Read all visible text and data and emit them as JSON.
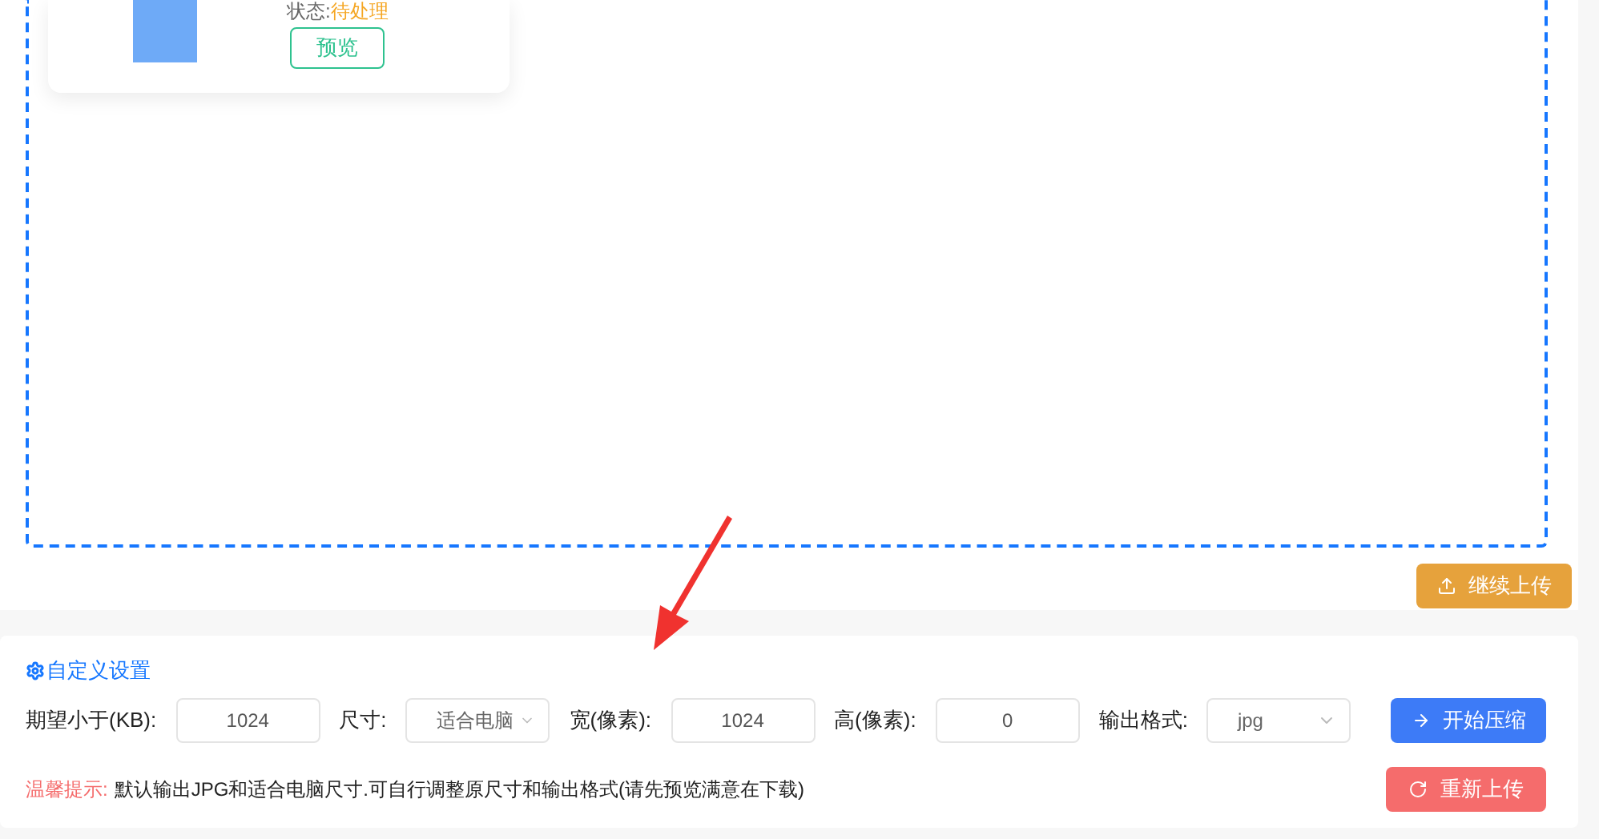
{
  "file_card": {
    "status_label": "状态:",
    "status": "待处理",
    "preview_button": "预览"
  },
  "continue_upload_button": "继续上传",
  "settings": {
    "title": "自定义设置",
    "fields": [
      {
        "kind": "input",
        "label": "期望小于(KB):",
        "value": "1024"
      },
      {
        "kind": "select",
        "label": "尺寸:",
        "value": "适合电脑"
      },
      {
        "kind": "input",
        "label": "宽(像素):",
        "value": "1024"
      },
      {
        "kind": "input",
        "label": "高(像素):",
        "value": "0"
      },
      {
        "kind": "select",
        "label": "输出格式:",
        "value": "jpg"
      }
    ],
    "start_button": "开始压缩",
    "tip_label": "温馨提示:",
    "tip_text": "默认输出JPG和适合电脑尺寸.可自行调整原尺寸和输出格式(请先预览满意在下载)",
    "reupload_button": "重新上传"
  }
}
